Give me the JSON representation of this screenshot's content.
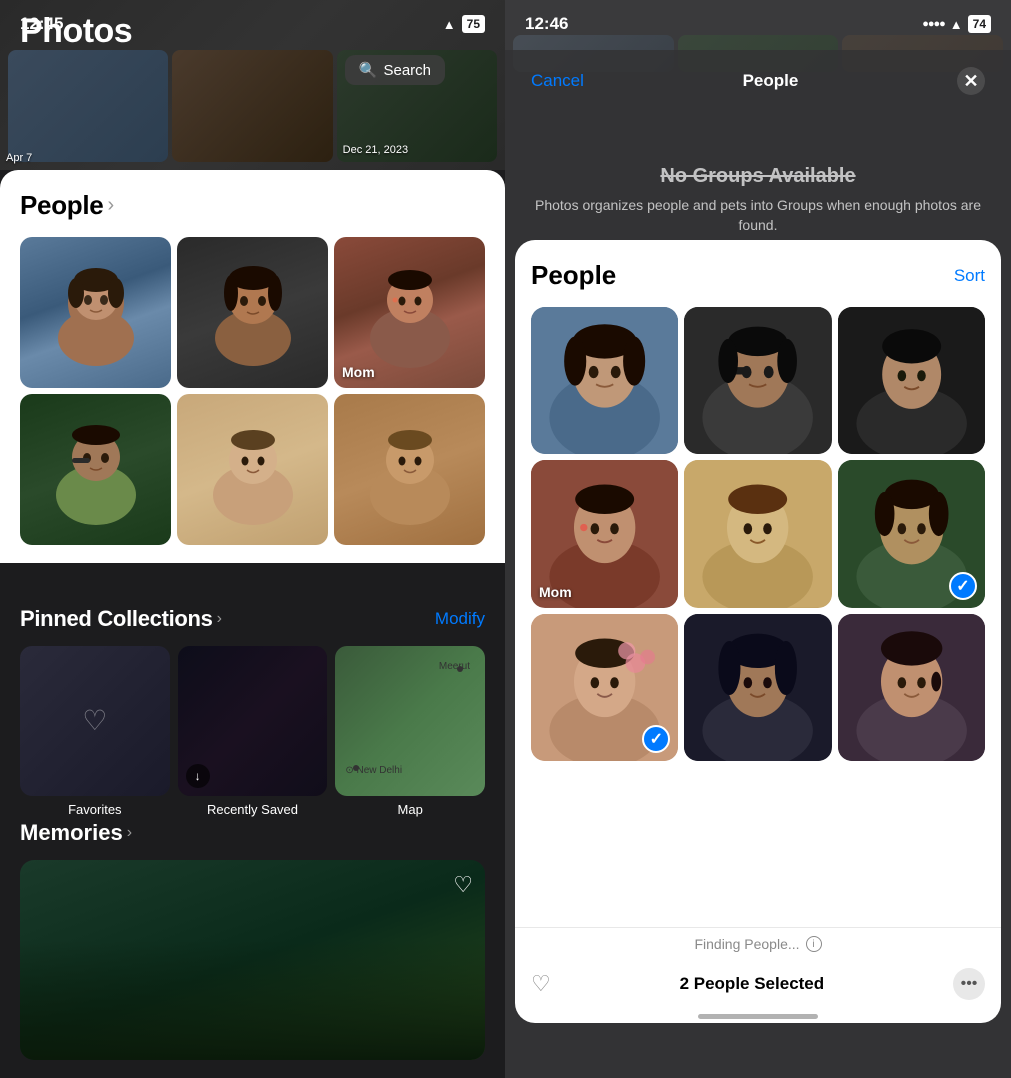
{
  "left": {
    "time": "12:45",
    "wifi_icon": "wifi",
    "battery_level": "75",
    "title": "Photos",
    "search_label": "Search",
    "people_section": {
      "title": "People",
      "chevron": "›",
      "persons": [
        {
          "id": 1,
          "label": "",
          "has_label": false
        },
        {
          "id": 2,
          "label": "",
          "has_label": false
        },
        {
          "id": 3,
          "label": "Mom",
          "has_label": true
        },
        {
          "id": 4,
          "label": "",
          "has_label": false
        },
        {
          "id": 5,
          "label": "",
          "has_label": false
        },
        {
          "id": 6,
          "label": "",
          "has_label": false
        }
      ]
    },
    "bg_date": "Dec 21, 2023",
    "bg_date2": "Apr 7",
    "pinned": {
      "title": "Pinned Collections",
      "chevron": "›",
      "modify_label": "Modify",
      "items": [
        {
          "id": "favorites",
          "label": "Favorites"
        },
        {
          "id": "recently-saved",
          "label": "Recently Saved"
        },
        {
          "id": "map",
          "label": "Map"
        }
      ],
      "map_label_meerut": "Meerut",
      "map_label_delhi": "⊙ New Delhi"
    },
    "memories": {
      "title": "Memories",
      "chevron": "›"
    }
  },
  "right": {
    "time": "12:46",
    "battery_level": "74",
    "modal_bar": {
      "cancel_label": "Cancel",
      "title": "People",
      "close_label": "✕"
    },
    "no_groups": {
      "title": "No Groups Available",
      "subtitle": "Photos organizes people and pets into Groups when enough photos are found."
    },
    "people_modal": {
      "title": "People",
      "sort_label": "Sort",
      "persons": [
        {
          "id": 1,
          "label": "",
          "selected": false,
          "face_class": "mface-1"
        },
        {
          "id": 2,
          "label": "",
          "selected": false,
          "face_class": "mface-2"
        },
        {
          "id": 3,
          "label": "",
          "selected": false,
          "face_class": "mface-3"
        },
        {
          "id": 4,
          "label": "Mom",
          "selected": false,
          "face_class": "mface-4"
        },
        {
          "id": 5,
          "label": "",
          "selected": false,
          "face_class": "mface-5"
        },
        {
          "id": 6,
          "label": "",
          "selected": true,
          "face_class": "mface-6"
        },
        {
          "id": 7,
          "label": "",
          "selected": true,
          "face_class": "mface-7"
        },
        {
          "id": 8,
          "label": "",
          "selected": false,
          "face_class": "mface-8"
        },
        {
          "id": 9,
          "label": "",
          "selected": false,
          "face_class": "mface-9"
        }
      ]
    },
    "bottom": {
      "finding_label": "Finding People...",
      "selected_count_label": "2 People Selected",
      "heart_icon": "♡",
      "ellipsis_icon": "···"
    }
  }
}
